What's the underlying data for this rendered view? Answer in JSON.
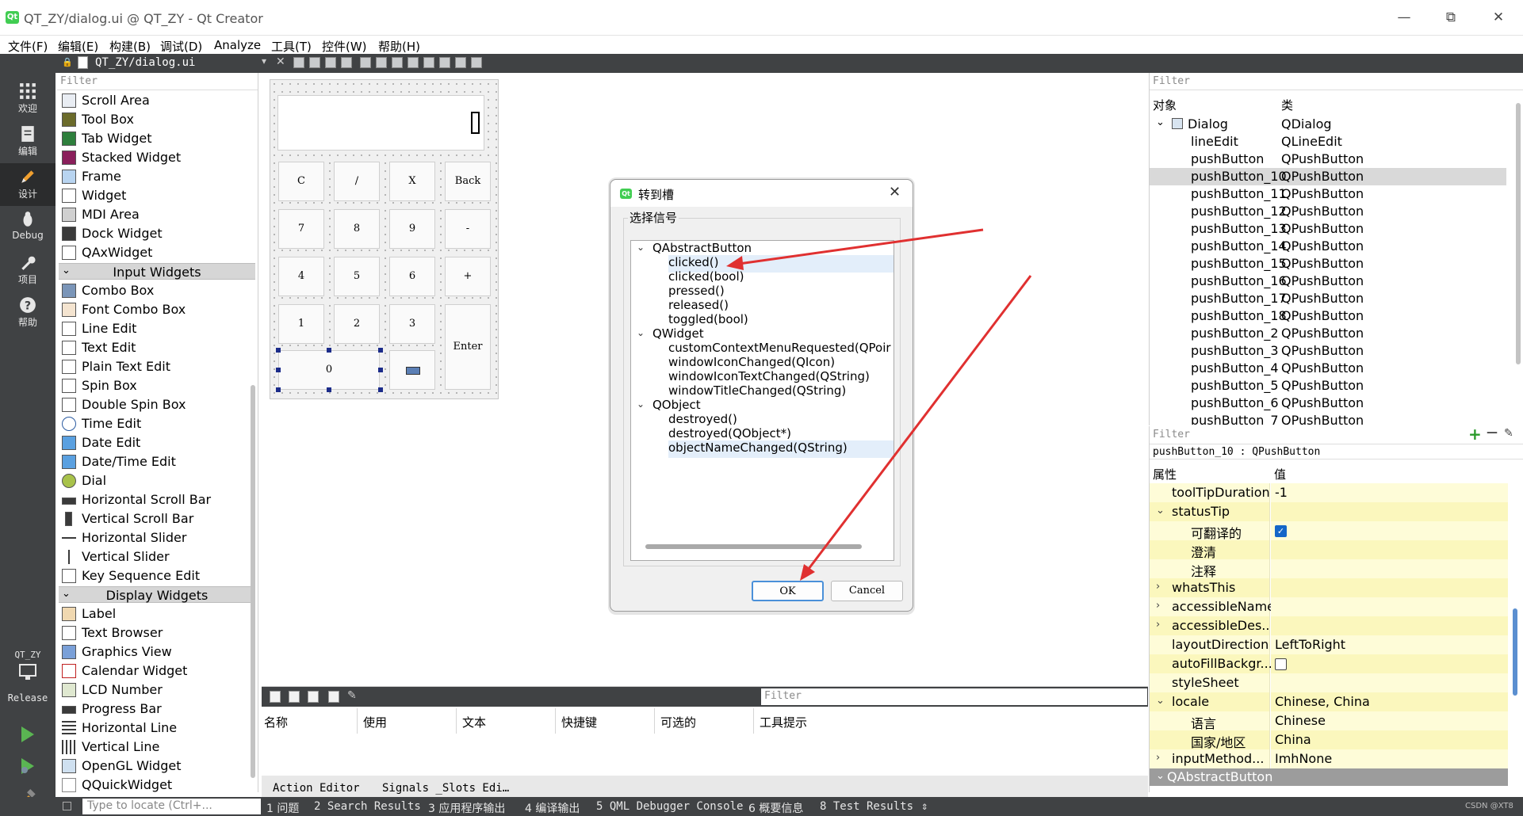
{
  "window": {
    "title": "QT_ZY/dialog.ui @ QT_ZY - Qt Creator",
    "logo_text": "Qt",
    "minimize": "—",
    "restore": "⧉",
    "close": "✕"
  },
  "menu": [
    "文件(F)",
    "编辑(E)",
    "构建(B)",
    "调试(D)",
    "Analyze",
    "工具(T)",
    "控件(W)",
    "帮助(H)"
  ],
  "modes": [
    {
      "label": "欢迎",
      "icon": "welcome-grid-icon"
    },
    {
      "label": "编辑",
      "icon": "edit-doc-icon"
    },
    {
      "label": "设计",
      "icon": "design-pencil-icon"
    },
    {
      "label": "Debug",
      "icon": "debug-bug-icon"
    },
    {
      "label": "项目",
      "icon": "projects-wrench-icon"
    },
    {
      "label": "帮助",
      "icon": "help-question-icon"
    }
  ],
  "kit": {
    "project": "QT_ZY",
    "config": "Release"
  },
  "editor": {
    "open_file": "QT_ZY/dialog.ui"
  },
  "widgetbox": {
    "filter_placeholder": "Filter",
    "items_top": [
      "Scroll Area",
      "Tool Box",
      "Tab Widget",
      "Stacked Widget",
      "Frame",
      "Widget",
      "MDI Area",
      "Dock Widget",
      "QAxWidget"
    ],
    "cat_input": "Input Widgets",
    "items_input": [
      "Combo Box",
      "Font Combo Box",
      "Line Edit",
      "Text Edit",
      "Plain Text Edit",
      "Spin Box",
      "Double Spin Box",
      "Time Edit",
      "Date Edit",
      "Date/Time Edit",
      "Dial",
      "Horizontal Scroll Bar",
      "Vertical Scroll Bar",
      "Horizontal Slider",
      "Vertical Slider",
      "Key Sequence Edit"
    ],
    "cat_display": "Display Widgets",
    "items_display": [
      "Label",
      "Text Browser",
      "Graphics View",
      "Calendar Widget",
      "LCD Number",
      "Progress Bar",
      "Horizontal Line",
      "Vertical Line",
      "OpenGL Widget",
      "QQuickWidget"
    ]
  },
  "form": {
    "buttons": [
      "C",
      "/",
      "X",
      "Back",
      "7",
      "8",
      "9",
      "-",
      "4",
      "5",
      "6",
      "+",
      "1",
      "2",
      "3",
      "Enter",
      "0"
    ]
  },
  "dialog": {
    "title": "转到槽",
    "group_label": "选择信号",
    "groups": [
      {
        "name": "QAbstractButton",
        "signals": [
          "clicked()",
          "clicked(bool)",
          "pressed()",
          "released()",
          "toggled(bool)"
        ]
      },
      {
        "name": "QWidget",
        "signals": [
          "customContextMenuRequested(QPoir",
          "windowIconChanged(QIcon)",
          "windowIconTextChanged(QString)",
          "windowTitleChanged(QString)"
        ]
      },
      {
        "name": "QObject",
        "signals": [
          "destroyed()",
          "destroyed(QObject*)",
          "objectNameChanged(QString)"
        ]
      }
    ],
    "ok": "OK",
    "cancel": "Cancel"
  },
  "action_editor": {
    "filter_placeholder": "Filter",
    "columns": [
      "名称",
      "使用",
      "文本",
      "快捷键",
      "可选的",
      "工具提示"
    ],
    "tabs": [
      "Action Editor",
      "Signals _Slots Edi…"
    ]
  },
  "object_inspector": {
    "filter_placeholder": "Filter",
    "headers": [
      "对象",
      "类"
    ],
    "root": {
      "name": "Dialog",
      "class": "QDialog"
    },
    "children": [
      {
        "name": "lineEdit",
        "class": "QLineEdit"
      },
      {
        "name": "pushButton",
        "class": "QPushButton"
      },
      {
        "name": "pushButton_10",
        "class": "QPushButton"
      },
      {
        "name": "pushButton_11",
        "class": "QPushButton"
      },
      {
        "name": "pushButton_12",
        "class": "QPushButton"
      },
      {
        "name": "pushButton_13",
        "class": "QPushButton"
      },
      {
        "name": "pushButton_14",
        "class": "QPushButton"
      },
      {
        "name": "pushButton_15",
        "class": "QPushButton"
      },
      {
        "name": "pushButton_16",
        "class": "QPushButton"
      },
      {
        "name": "pushButton_17",
        "class": "QPushButton"
      },
      {
        "name": "pushButton_18",
        "class": "QPushButton"
      },
      {
        "name": "pushButton_2",
        "class": "QPushButton"
      },
      {
        "name": "pushButton_3",
        "class": "QPushButton"
      },
      {
        "name": "pushButton_4",
        "class": "QPushButton"
      },
      {
        "name": "pushButton_5",
        "class": "QPushButton"
      },
      {
        "name": "pushButton_6",
        "class": "QPushButton"
      },
      {
        "name": "pushButton_7",
        "class": "QPushButton"
      }
    ]
  },
  "property_editor": {
    "filter_placeholder": "Filter",
    "add": "+",
    "remove": "—",
    "current": "pushButton_10 : QPushButton",
    "headers": [
      "属性",
      "值"
    ],
    "rows": [
      {
        "name": "toolTipDuration",
        "value": "-1"
      },
      {
        "name": "statusTip",
        "value": ""
      },
      {
        "name": "可翻译的",
        "value": ""
      },
      {
        "name": "澄清",
        "value": ""
      },
      {
        "name": "注释",
        "value": ""
      },
      {
        "name": "whatsThis",
        "value": ""
      },
      {
        "name": "accessibleName",
        "value": ""
      },
      {
        "name": "accessibleDes...",
        "value": ""
      },
      {
        "name": "layoutDirection",
        "value": "LeftToRight"
      },
      {
        "name": "autoFillBackgr...",
        "value": ""
      },
      {
        "name": "styleSheet",
        "value": ""
      },
      {
        "name": "locale",
        "value": "Chinese, China"
      },
      {
        "name": "语言",
        "value": "Chinese"
      },
      {
        "name": "国家/地区",
        "value": "China"
      },
      {
        "name": "inputMethod...",
        "value": "ImhNone"
      }
    ],
    "section": "QAbstractButton"
  },
  "statusbar": {
    "locate_placeholder": "Type to locate (Ctrl+...",
    "items": [
      "1 问题",
      "2 Search Results",
      "3 应用程序输出",
      "4 编译输出",
      "5 QML Debugger Console",
      "6 概要信息",
      "8 Test Results"
    ],
    "watermark": "CSDN @XT8"
  }
}
